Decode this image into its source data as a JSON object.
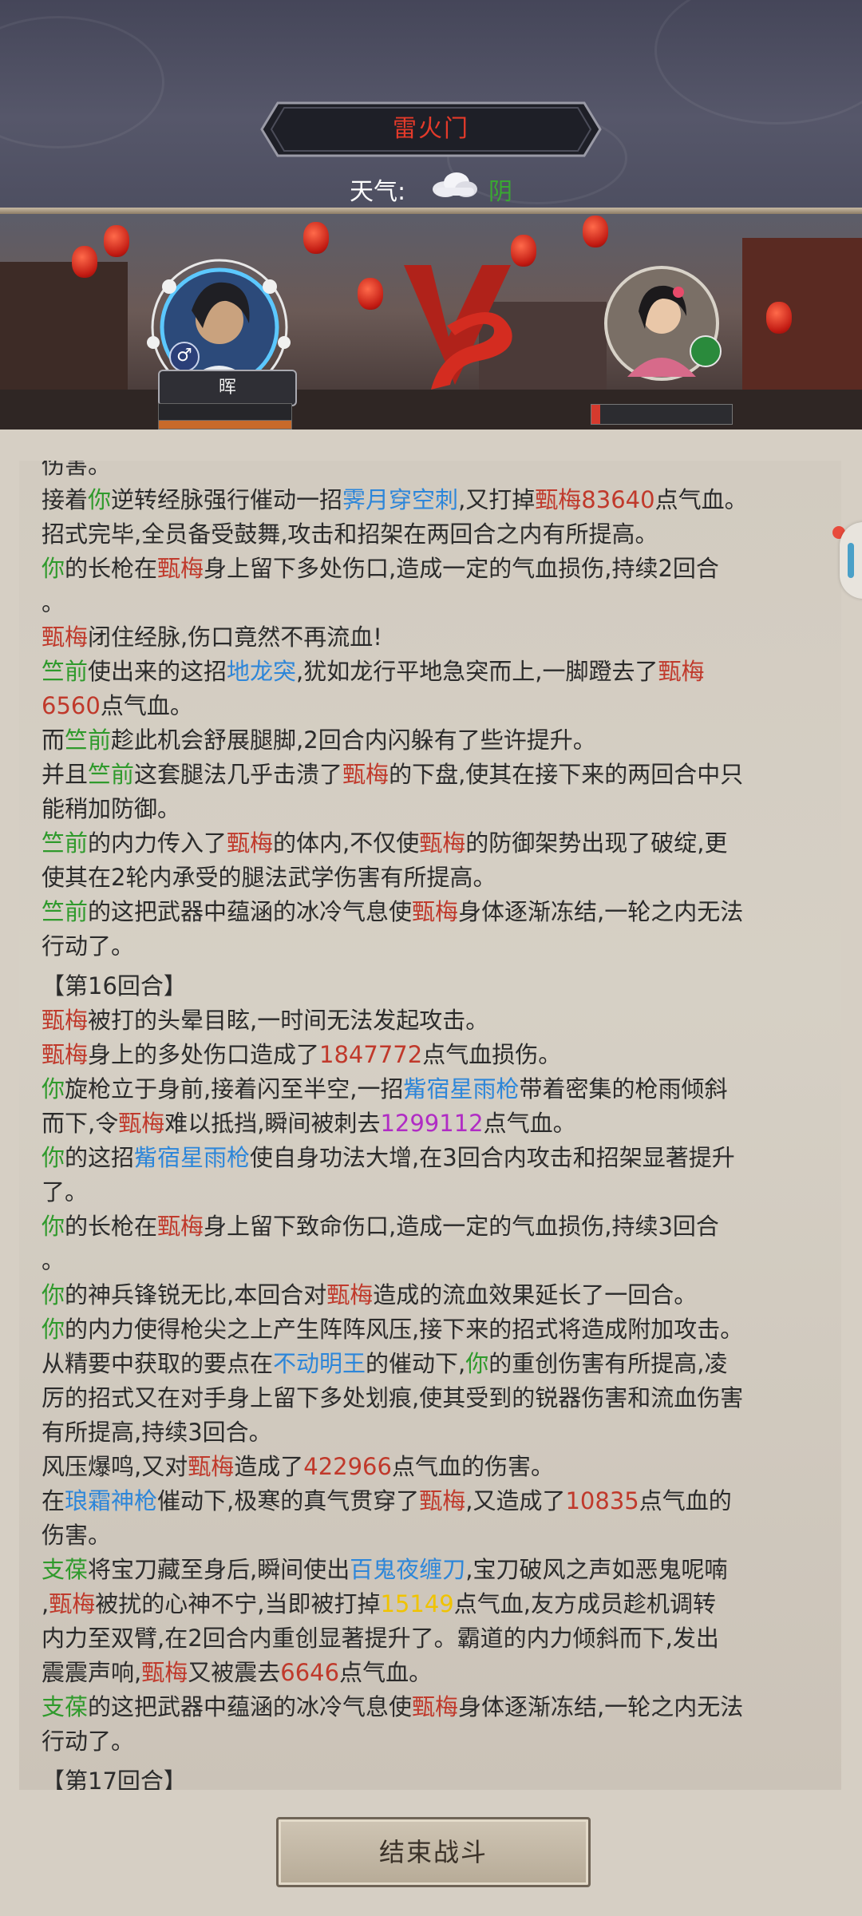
{
  "header": {
    "sect_name": "雷火门",
    "weather_label": "天气:",
    "weather_icon": "cloud-icon",
    "weather_value": "阴"
  },
  "battle": {
    "player_name": "晖",
    "player_gender_icon": "male-icon",
    "vs_icon": "vs-icon",
    "enemy_weapon_icon": "sword-icon",
    "enemy_hp_fraction": 0.06
  },
  "colors": {
    "self": "#2f9a2c",
    "enemy": "#c0392b",
    "skill": "#2d86d9",
    "damage": "#c0392b",
    "crit_damage": "#b02cc4",
    "gold_damage": "#f0c300"
  },
  "log": {
    "lines": [
      {
        "type": "text",
        "segments": [
          {
            "t": "伤害。",
            "c": ""
          }
        ]
      },
      {
        "type": "text",
        "segments": [
          {
            "t": "接着",
            "c": ""
          },
          {
            "t": "你",
            "c": "g"
          },
          {
            "t": "逆转经脉强行催动一招",
            "c": ""
          },
          {
            "t": "霁月穿空刺",
            "c": "b"
          },
          {
            "t": ",又打掉",
            "c": ""
          },
          {
            "t": "甄梅",
            "c": "r"
          },
          {
            "t": "83640",
            "c": "r"
          },
          {
            "t": "点气血。",
            "c": ""
          }
        ]
      },
      {
        "type": "text",
        "segments": [
          {
            "t": "招式完毕,全员备受鼓舞,攻击和招架在两回合之内有所提高。",
            "c": ""
          }
        ]
      },
      {
        "type": "text",
        "segments": [
          {
            "t": "你",
            "c": "g"
          },
          {
            "t": "的长枪在",
            "c": ""
          },
          {
            "t": "甄梅",
            "c": "r"
          },
          {
            "t": "身上留下多处伤口,造成一定的气血损伤,持续2回合",
            "c": ""
          }
        ]
      },
      {
        "type": "text",
        "segments": [
          {
            "t": "。",
            "c": ""
          }
        ]
      },
      {
        "type": "text",
        "segments": [
          {
            "t": "甄梅",
            "c": "r"
          },
          {
            "t": "闭住经脉,伤口竟然不再流血!",
            "c": ""
          }
        ]
      },
      {
        "type": "text",
        "segments": [
          {
            "t": "竺前",
            "c": "g"
          },
          {
            "t": "使出来的这招",
            "c": ""
          },
          {
            "t": "地龙突",
            "c": "b"
          },
          {
            "t": ",犹如龙行平地急突而上,一脚蹬去了",
            "c": ""
          },
          {
            "t": "甄梅",
            "c": "r"
          }
        ]
      },
      {
        "type": "text",
        "segments": [
          {
            "t": "6560",
            "c": "r"
          },
          {
            "t": "点气血。",
            "c": ""
          }
        ]
      },
      {
        "type": "text",
        "segments": [
          {
            "t": "而",
            "c": ""
          },
          {
            "t": "竺前",
            "c": "g"
          },
          {
            "t": "趁此机会舒展腿脚,2回合内闪躲有了些许提升。",
            "c": ""
          }
        ]
      },
      {
        "type": "text",
        "segments": [
          {
            "t": "并且",
            "c": ""
          },
          {
            "t": "竺前",
            "c": "g"
          },
          {
            "t": "这套腿法几乎击溃了",
            "c": ""
          },
          {
            "t": "甄梅",
            "c": "r"
          },
          {
            "t": "的下盘,使其在接下来的两回合中只",
            "c": ""
          }
        ]
      },
      {
        "type": "text",
        "segments": [
          {
            "t": "能稍加防御。",
            "c": ""
          }
        ]
      },
      {
        "type": "text",
        "segments": [
          {
            "t": "竺前",
            "c": "g"
          },
          {
            "t": "的内力传入了",
            "c": ""
          },
          {
            "t": "甄梅",
            "c": "r"
          },
          {
            "t": "的体内,不仅使",
            "c": ""
          },
          {
            "t": "甄梅",
            "c": "r"
          },
          {
            "t": "的防御架势出现了破绽,更",
            "c": ""
          }
        ]
      },
      {
        "type": "text",
        "segments": [
          {
            "t": "使其在2轮内承受的腿法武学伤害有所提高。",
            "c": ""
          }
        ]
      },
      {
        "type": "text",
        "segments": [
          {
            "t": "竺前",
            "c": "g"
          },
          {
            "t": "的这把武器中蕴涵的冰冷气息使",
            "c": ""
          },
          {
            "t": "甄梅",
            "c": "r"
          },
          {
            "t": "身体逐渐冻结,一轮之内无法",
            "c": ""
          }
        ]
      },
      {
        "type": "text",
        "segments": [
          {
            "t": "行动了。",
            "c": ""
          }
        ]
      },
      {
        "type": "round",
        "segments": [
          {
            "t": "【第16回合】",
            "c": ""
          }
        ]
      },
      {
        "type": "text",
        "segments": [
          {
            "t": "甄梅",
            "c": "r"
          },
          {
            "t": "被打的头晕目眩,一时间无法发起攻击。",
            "c": ""
          }
        ]
      },
      {
        "type": "text",
        "segments": [
          {
            "t": "甄梅",
            "c": "r"
          },
          {
            "t": "身上的多处伤口造成了",
            "c": ""
          },
          {
            "t": "1847772",
            "c": "r"
          },
          {
            "t": "点气血损伤。",
            "c": ""
          }
        ]
      },
      {
        "type": "text",
        "segments": [
          {
            "t": "你",
            "c": "g"
          },
          {
            "t": "旋枪立于身前,接着闪至半空,一招",
            "c": ""
          },
          {
            "t": "觜宿星雨枪",
            "c": "b"
          },
          {
            "t": "带着密集的枪雨倾斜",
            "c": ""
          }
        ]
      },
      {
        "type": "text",
        "segments": [
          {
            "t": "而下,令",
            "c": ""
          },
          {
            "t": "甄梅",
            "c": "r"
          },
          {
            "t": "难以抵挡,瞬间被刺去",
            "c": ""
          },
          {
            "t": "1299112",
            "c": "p"
          },
          {
            "t": "点气血。",
            "c": ""
          }
        ]
      },
      {
        "type": "text",
        "segments": [
          {
            "t": "你",
            "c": "g"
          },
          {
            "t": "的这招",
            "c": ""
          },
          {
            "t": "觜宿星雨枪",
            "c": "b"
          },
          {
            "t": "使自身功法大增,在3回合内攻击和招架显著提升",
            "c": ""
          }
        ]
      },
      {
        "type": "text",
        "segments": [
          {
            "t": "了。",
            "c": ""
          }
        ]
      },
      {
        "type": "text",
        "segments": [
          {
            "t": "你",
            "c": "g"
          },
          {
            "t": "的长枪在",
            "c": ""
          },
          {
            "t": "甄梅",
            "c": "r"
          },
          {
            "t": "身上留下致命伤口,造成一定的气血损伤,持续3回合",
            "c": ""
          }
        ]
      },
      {
        "type": "text",
        "segments": [
          {
            "t": "。",
            "c": ""
          }
        ]
      },
      {
        "type": "text",
        "segments": [
          {
            "t": "你",
            "c": "g"
          },
          {
            "t": "的神兵锋锐无比,本回合对",
            "c": ""
          },
          {
            "t": "甄梅",
            "c": "r"
          },
          {
            "t": "造成的流血效果延长了一回合。",
            "c": ""
          }
        ]
      },
      {
        "type": "text",
        "segments": [
          {
            "t": "你",
            "c": "g"
          },
          {
            "t": "的内力使得枪尖之上产生阵阵风压,接下来的招式将造成附加攻击。",
            "c": ""
          }
        ]
      },
      {
        "type": "text",
        "segments": [
          {
            "t": "从精要中获取的要点在",
            "c": ""
          },
          {
            "t": "不动明王",
            "c": "b"
          },
          {
            "t": "的催动下,",
            "c": ""
          },
          {
            "t": "你",
            "c": "g"
          },
          {
            "t": "的重创伤害有所提高,凌",
            "c": ""
          }
        ]
      },
      {
        "type": "text",
        "segments": [
          {
            "t": "厉的招式又在对手身上留下多处划痕,使其受到的锐器伤害和流血伤害",
            "c": ""
          }
        ]
      },
      {
        "type": "text",
        "segments": [
          {
            "t": "有所提高,持续3回合。",
            "c": ""
          }
        ]
      },
      {
        "type": "text",
        "segments": [
          {
            "t": "风压爆鸣,又对",
            "c": ""
          },
          {
            "t": "甄梅",
            "c": "r"
          },
          {
            "t": "造成了",
            "c": ""
          },
          {
            "t": "422966",
            "c": "r"
          },
          {
            "t": "点气血的伤害。",
            "c": ""
          }
        ]
      },
      {
        "type": "text",
        "segments": [
          {
            "t": "在",
            "c": ""
          },
          {
            "t": "琅霜神枪",
            "c": "b"
          },
          {
            "t": "催动下,极寒的真气贯穿了",
            "c": ""
          },
          {
            "t": "甄梅",
            "c": "r"
          },
          {
            "t": ",又造成了",
            "c": ""
          },
          {
            "t": "10835",
            "c": "r"
          },
          {
            "t": "点气血的",
            "c": ""
          }
        ]
      },
      {
        "type": "text",
        "segments": [
          {
            "t": "伤害。",
            "c": ""
          }
        ]
      },
      {
        "type": "text",
        "segments": [
          {
            "t": "支葆",
            "c": "g"
          },
          {
            "t": "将宝刀藏至身后,瞬间使出",
            "c": ""
          },
          {
            "t": "百鬼夜缠刀",
            "c": "b"
          },
          {
            "t": ",宝刀破风之声如恶鬼呢喃",
            "c": ""
          }
        ]
      },
      {
        "type": "text",
        "segments": [
          {
            "t": ",",
            "c": ""
          },
          {
            "t": "甄梅",
            "c": "r"
          },
          {
            "t": "被扰的心神不宁,当即被打掉",
            "c": ""
          },
          {
            "t": "15149",
            "c": "y"
          },
          {
            "t": "点气血,友方成员趁机调转",
            "c": ""
          }
        ]
      },
      {
        "type": "text",
        "segments": [
          {
            "t": "内力至双臂,在2回合内重创显著提升了。霸道的内力倾斜而下,发出",
            "c": ""
          }
        ]
      },
      {
        "type": "text",
        "segments": [
          {
            "t": "震震声响,",
            "c": ""
          },
          {
            "t": "甄梅",
            "c": "r"
          },
          {
            "t": "又被震去",
            "c": ""
          },
          {
            "t": "6646",
            "c": "r"
          },
          {
            "t": "点气血。",
            "c": ""
          }
        ]
      },
      {
        "type": "text",
        "segments": [
          {
            "t": "支葆",
            "c": "g"
          },
          {
            "t": "的这把武器中蕴涵的冰冷气息使",
            "c": ""
          },
          {
            "t": "甄梅",
            "c": "r"
          },
          {
            "t": "身体逐渐冻结,一轮之内无法",
            "c": ""
          }
        ]
      },
      {
        "type": "text",
        "segments": [
          {
            "t": "行动了。",
            "c": ""
          }
        ]
      },
      {
        "type": "round",
        "segments": [
          {
            "t": "【第17回合】",
            "c": ""
          }
        ]
      }
    ]
  },
  "footer": {
    "end_button_label": "结束战斗"
  }
}
